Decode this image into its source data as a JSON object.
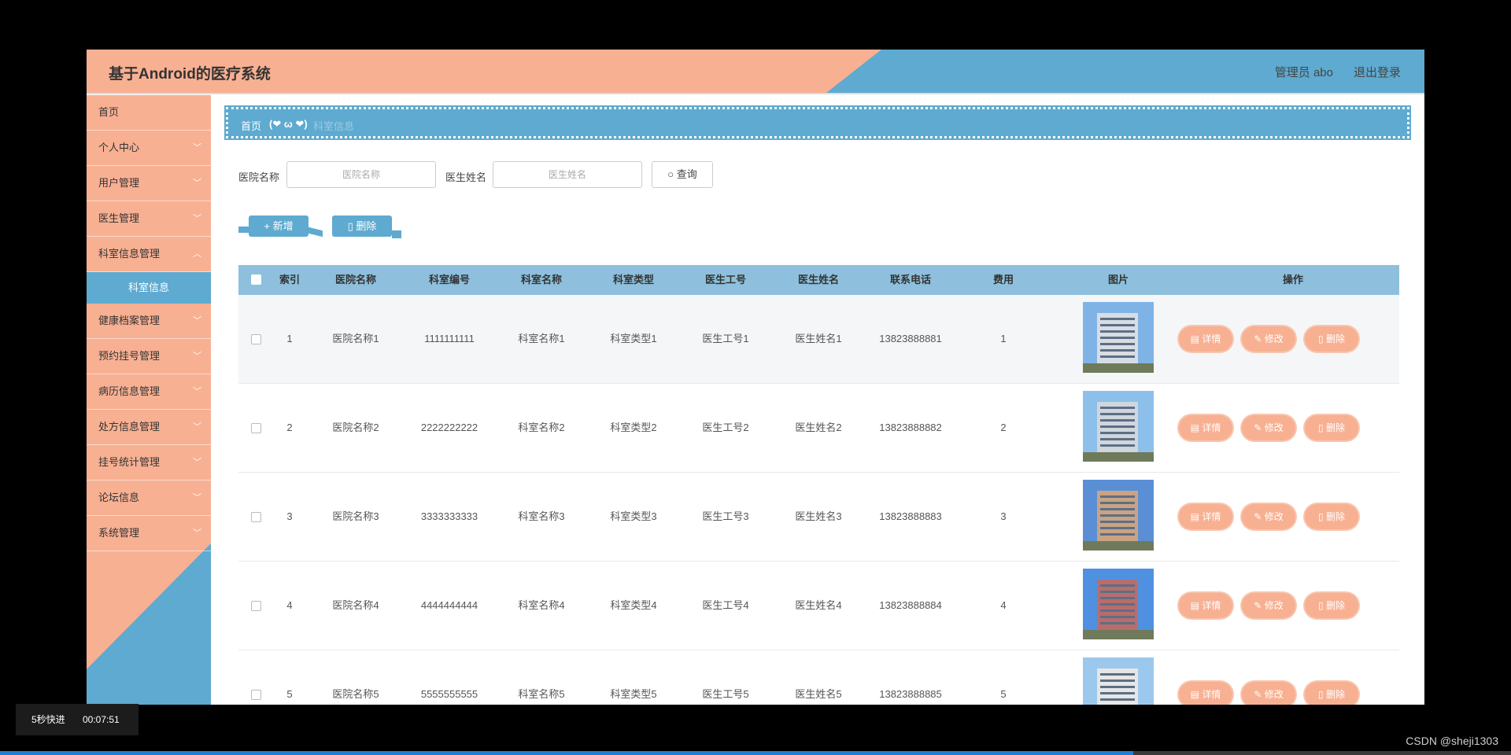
{
  "header": {
    "title": "基于Android的医疗系统",
    "user": "管理员 abo",
    "logout": "退出登录"
  },
  "sidebar": {
    "items": [
      {
        "label": "首页",
        "chevron": ""
      },
      {
        "label": "个人中心",
        "chevron": "﹀"
      },
      {
        "label": "用户管理",
        "chevron": "﹀"
      },
      {
        "label": "医生管理",
        "chevron": "﹀"
      },
      {
        "label": "科室信息管理",
        "chevron": "︿"
      }
    ],
    "sub_item": "科室信息",
    "items2": [
      {
        "label": "健康档案管理",
        "chevron": "﹀"
      },
      {
        "label": "预约挂号管理",
        "chevron": "﹀"
      },
      {
        "label": "病历信息管理",
        "chevron": "﹀"
      },
      {
        "label": "处方信息管理",
        "chevron": "﹀"
      },
      {
        "label": "挂号统计管理",
        "chevron": "﹀"
      },
      {
        "label": "论坛信息",
        "chevron": "﹀"
      },
      {
        "label": "系统管理",
        "chevron": "﹀"
      }
    ]
  },
  "breadcrumb": {
    "home": "首页",
    "emoji": "(❤ ω ❤)",
    "current": "科室信息"
  },
  "search": {
    "hospital_label": "医院名称",
    "hospital_placeholder": "医院名称",
    "doctor_label": "医生姓名",
    "doctor_placeholder": "医生姓名",
    "query_button": "查询"
  },
  "toolbar": {
    "add": "新增",
    "delete": "删除"
  },
  "table": {
    "headers": [
      "索引",
      "医院名称",
      "科室编号",
      "科室名称",
      "科室类型",
      "医生工号",
      "医生姓名",
      "联系电话",
      "费用",
      "图片",
      "操作"
    ],
    "rows": [
      [
        "1",
        "医院名称1",
        "1111111111",
        "科室名称1",
        "科室类型1",
        "医生工号1",
        "医生姓名1",
        "13823888881",
        "1"
      ],
      [
        "2",
        "医院名称2",
        "2222222222",
        "科室名称2",
        "科室类型2",
        "医生工号2",
        "医生姓名2",
        "13823888882",
        "2"
      ],
      [
        "3",
        "医院名称3",
        "3333333333",
        "科室名称3",
        "科室类型3",
        "医生工号3",
        "医生姓名3",
        "13823888883",
        "3"
      ],
      [
        "4",
        "医院名称4",
        "4444444444",
        "科室名称4",
        "科室类型4",
        "医生工号4",
        "医生姓名4",
        "13823888884",
        "4"
      ],
      [
        "5",
        "医院名称5",
        "5555555555",
        "科室名称5",
        "科室类型5",
        "医生工号5",
        "医生姓名5",
        "13823888885",
        "5"
      ]
    ],
    "actions": {
      "detail": "详情",
      "edit": "修改",
      "delete": "删除"
    }
  },
  "video": {
    "speed_label": "5秒快进",
    "time": "00:07:51",
    "progress": 0.75
  },
  "watermark": "CSDN @sheji1303",
  "colors": {
    "salmon": "#f8b092",
    "blue": "#5eaad0",
    "table_header": "#8ec0dd"
  }
}
